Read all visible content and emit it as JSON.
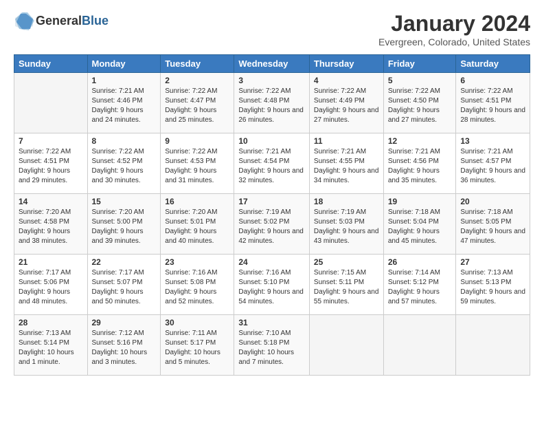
{
  "header": {
    "logo_general": "General",
    "logo_blue": "Blue",
    "month_title": "January 2024",
    "location": "Evergreen, Colorado, United States"
  },
  "days_of_week": [
    "Sunday",
    "Monday",
    "Tuesday",
    "Wednesday",
    "Thursday",
    "Friday",
    "Saturday"
  ],
  "weeks": [
    [
      {
        "num": "",
        "sunrise": "",
        "sunset": "",
        "daylight": "",
        "empty": true
      },
      {
        "num": "1",
        "sunrise": "Sunrise: 7:21 AM",
        "sunset": "Sunset: 4:46 PM",
        "daylight": "Daylight: 9 hours and 24 minutes."
      },
      {
        "num": "2",
        "sunrise": "Sunrise: 7:22 AM",
        "sunset": "Sunset: 4:47 PM",
        "daylight": "Daylight: 9 hours and 25 minutes."
      },
      {
        "num": "3",
        "sunrise": "Sunrise: 7:22 AM",
        "sunset": "Sunset: 4:48 PM",
        "daylight": "Daylight: 9 hours and 26 minutes."
      },
      {
        "num": "4",
        "sunrise": "Sunrise: 7:22 AM",
        "sunset": "Sunset: 4:49 PM",
        "daylight": "Daylight: 9 hours and 27 minutes."
      },
      {
        "num": "5",
        "sunrise": "Sunrise: 7:22 AM",
        "sunset": "Sunset: 4:50 PM",
        "daylight": "Daylight: 9 hours and 27 minutes."
      },
      {
        "num": "6",
        "sunrise": "Sunrise: 7:22 AM",
        "sunset": "Sunset: 4:51 PM",
        "daylight": "Daylight: 9 hours and 28 minutes."
      }
    ],
    [
      {
        "num": "7",
        "sunrise": "Sunrise: 7:22 AM",
        "sunset": "Sunset: 4:51 PM",
        "daylight": "Daylight: 9 hours and 29 minutes."
      },
      {
        "num": "8",
        "sunrise": "Sunrise: 7:22 AM",
        "sunset": "Sunset: 4:52 PM",
        "daylight": "Daylight: 9 hours and 30 minutes."
      },
      {
        "num": "9",
        "sunrise": "Sunrise: 7:22 AM",
        "sunset": "Sunset: 4:53 PM",
        "daylight": "Daylight: 9 hours and 31 minutes."
      },
      {
        "num": "10",
        "sunrise": "Sunrise: 7:21 AM",
        "sunset": "Sunset: 4:54 PM",
        "daylight": "Daylight: 9 hours and 32 minutes."
      },
      {
        "num": "11",
        "sunrise": "Sunrise: 7:21 AM",
        "sunset": "Sunset: 4:55 PM",
        "daylight": "Daylight: 9 hours and 34 minutes."
      },
      {
        "num": "12",
        "sunrise": "Sunrise: 7:21 AM",
        "sunset": "Sunset: 4:56 PM",
        "daylight": "Daylight: 9 hours and 35 minutes."
      },
      {
        "num": "13",
        "sunrise": "Sunrise: 7:21 AM",
        "sunset": "Sunset: 4:57 PM",
        "daylight": "Daylight: 9 hours and 36 minutes."
      }
    ],
    [
      {
        "num": "14",
        "sunrise": "Sunrise: 7:20 AM",
        "sunset": "Sunset: 4:58 PM",
        "daylight": "Daylight: 9 hours and 38 minutes."
      },
      {
        "num": "15",
        "sunrise": "Sunrise: 7:20 AM",
        "sunset": "Sunset: 5:00 PM",
        "daylight": "Daylight: 9 hours and 39 minutes."
      },
      {
        "num": "16",
        "sunrise": "Sunrise: 7:20 AM",
        "sunset": "Sunset: 5:01 PM",
        "daylight": "Daylight: 9 hours and 40 minutes."
      },
      {
        "num": "17",
        "sunrise": "Sunrise: 7:19 AM",
        "sunset": "Sunset: 5:02 PM",
        "daylight": "Daylight: 9 hours and 42 minutes."
      },
      {
        "num": "18",
        "sunrise": "Sunrise: 7:19 AM",
        "sunset": "Sunset: 5:03 PM",
        "daylight": "Daylight: 9 hours and 43 minutes."
      },
      {
        "num": "19",
        "sunrise": "Sunrise: 7:18 AM",
        "sunset": "Sunset: 5:04 PM",
        "daylight": "Daylight: 9 hours and 45 minutes."
      },
      {
        "num": "20",
        "sunrise": "Sunrise: 7:18 AM",
        "sunset": "Sunset: 5:05 PM",
        "daylight": "Daylight: 9 hours and 47 minutes."
      }
    ],
    [
      {
        "num": "21",
        "sunrise": "Sunrise: 7:17 AM",
        "sunset": "Sunset: 5:06 PM",
        "daylight": "Daylight: 9 hours and 48 minutes."
      },
      {
        "num": "22",
        "sunrise": "Sunrise: 7:17 AM",
        "sunset": "Sunset: 5:07 PM",
        "daylight": "Daylight: 9 hours and 50 minutes."
      },
      {
        "num": "23",
        "sunrise": "Sunrise: 7:16 AM",
        "sunset": "Sunset: 5:08 PM",
        "daylight": "Daylight: 9 hours and 52 minutes."
      },
      {
        "num": "24",
        "sunrise": "Sunrise: 7:16 AM",
        "sunset": "Sunset: 5:10 PM",
        "daylight": "Daylight: 9 hours and 54 minutes."
      },
      {
        "num": "25",
        "sunrise": "Sunrise: 7:15 AM",
        "sunset": "Sunset: 5:11 PM",
        "daylight": "Daylight: 9 hours and 55 minutes."
      },
      {
        "num": "26",
        "sunrise": "Sunrise: 7:14 AM",
        "sunset": "Sunset: 5:12 PM",
        "daylight": "Daylight: 9 hours and 57 minutes."
      },
      {
        "num": "27",
        "sunrise": "Sunrise: 7:13 AM",
        "sunset": "Sunset: 5:13 PM",
        "daylight": "Daylight: 9 hours and 59 minutes."
      }
    ],
    [
      {
        "num": "28",
        "sunrise": "Sunrise: 7:13 AM",
        "sunset": "Sunset: 5:14 PM",
        "daylight": "Daylight: 10 hours and 1 minute."
      },
      {
        "num": "29",
        "sunrise": "Sunrise: 7:12 AM",
        "sunset": "Sunset: 5:16 PM",
        "daylight": "Daylight: 10 hours and 3 minutes."
      },
      {
        "num": "30",
        "sunrise": "Sunrise: 7:11 AM",
        "sunset": "Sunset: 5:17 PM",
        "daylight": "Daylight: 10 hours and 5 minutes."
      },
      {
        "num": "31",
        "sunrise": "Sunrise: 7:10 AM",
        "sunset": "Sunset: 5:18 PM",
        "daylight": "Daylight: 10 hours and 7 minutes."
      },
      {
        "num": "",
        "sunrise": "",
        "sunset": "",
        "daylight": "",
        "empty": true
      },
      {
        "num": "",
        "sunrise": "",
        "sunset": "",
        "daylight": "",
        "empty": true
      },
      {
        "num": "",
        "sunrise": "",
        "sunset": "",
        "daylight": "",
        "empty": true
      }
    ]
  ]
}
